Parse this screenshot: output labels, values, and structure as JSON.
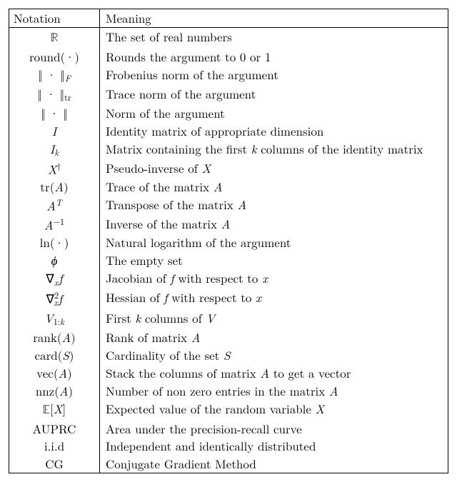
{
  "header": {
    "notation": "Notation",
    "meaning": "Meaning"
  },
  "rows": [
    {
      "n": "<span class='bb'>ℝ</span>",
      "m": "The set of real numbers"
    },
    {
      "n": "round(·)",
      "m": "Rounds the argument to 0 or 1"
    },
    {
      "n": "‖ · ‖<span class='subi'>F</span>",
      "m": "Frobenius norm of the argument"
    },
    {
      "n": "‖ · ‖<span class='sub'>tr</span>",
      "m": "Trace norm of the argument"
    },
    {
      "n": "‖ · ‖",
      "m": "Norm of the argument"
    },
    {
      "n": "<span class='mi'>I</span>",
      "m": "Identity matrix of appropriate dimension"
    },
    {
      "n": "<span class='mi'>I</span><span class='subi'>k</span>",
      "m": "Matrix containing the first <span class='mi'>k</span> columns of the identity matrix"
    },
    {
      "n": "<span class='mi'>X</span><span class='sup'>†</span>",
      "m": "Pseudo-inverse of <span class='mi'>X</span>"
    },
    {
      "n": "tr(<span class='mi'>A</span>)",
      "m": "Trace of the matrix <span class='mi'>A</span>"
    },
    {
      "n": "<span class='mi'>A</span><span class='supi'>T</span>",
      "m": "Transpose of the matrix <span class='mi'>A</span>"
    },
    {
      "n": "<span class='mi'>A</span><span class='sup'>−1</span>",
      "m": "Inverse of the matrix <span class='mi'>A</span>"
    },
    {
      "n": "ln(·)",
      "m": "Natural logarithm of the argument"
    },
    {
      "n": "<span class='mi'>ϕ</span>",
      "m": "The empty set"
    },
    {
      "n": "∇<span class='subi'>x</span><span class='mi'>&#8202;f</span>",
      "m": "Jacobian of <span class='mi'>f</span> with respect to <span class='mi'>x</span>"
    },
    {
      "n": "∇<span class='sup'>2</span><span class='subi' style='margin-left:-0.55em;'>x</span><span class='mi'>&#8202;f</span>",
      "m": "Hessian of <span class='mi'>f</span> with respect to <span class='mi'>x</span>"
    },
    {
      "n": "<span class='mi'>V</span><span class='sub'>1:<span class='mi'>k</span></span>",
      "m": "First <span class='mi'>k</span> columns of <span class='mi'>V</span>"
    },
    {
      "n": "rank(<span class='mi'>A</span>)",
      "m": "Rank of matrix <span class='mi'>A</span>"
    },
    {
      "n": "card(<span class='mi'>S</span>)",
      "m": "Cardinality of the set <span class='mi'>S</span>"
    },
    {
      "n": "vec(<span class='mi'>A</span>)",
      "m": "Stack the columns of matrix <span class='mi'>A</span> to get a vector"
    },
    {
      "n": "nnz(<span class='mi'>A</span>)",
      "m": "Number of non zero entries in the matrix <span class='mi'>A</span>"
    },
    {
      "n": "<span class='bb'>𝔼</span>[<span class='mi'>X</span>]",
      "m": "Expected value of the random variable <span class='mi'>X</span>"
    },
    {
      "n": "AUPRC",
      "m": "Area under the precision-recall curve"
    },
    {
      "n": "i.i.d",
      "m": "Independent and identically distributed"
    },
    {
      "n": "CG",
      "m": "Conjugate Gradient Method"
    }
  ],
  "chart_data": {
    "type": "table",
    "title": "Notation table",
    "columns": [
      "Notation",
      "Meaning"
    ],
    "records": [
      [
        "ℝ",
        "The set of real numbers"
      ],
      [
        "round(·)",
        "Rounds the argument to 0 or 1"
      ],
      [
        "‖·‖_F",
        "Frobenius norm of the argument"
      ],
      [
        "‖·‖_tr",
        "Trace norm of the argument"
      ],
      [
        "‖·‖",
        "Norm of the argument"
      ],
      [
        "I",
        "Identity matrix of appropriate dimension"
      ],
      [
        "I_k",
        "Matrix containing the first k columns of the identity matrix"
      ],
      [
        "X†",
        "Pseudo-inverse of X"
      ],
      [
        "tr(A)",
        "Trace of the matrix A"
      ],
      [
        "A^T",
        "Transpose of the matrix A"
      ],
      [
        "A^{-1}",
        "Inverse of the matrix A"
      ],
      [
        "ln(·)",
        "Natural logarithm of the argument"
      ],
      [
        "ϕ",
        "The empty set"
      ],
      [
        "∇_x f",
        "Jacobian of f with respect to x"
      ],
      [
        "∇_x^2 f",
        "Hessian of f with respect to x"
      ],
      [
        "V_{1:k}",
        "First k columns of V"
      ],
      [
        "rank(A)",
        "Rank of matrix A"
      ],
      [
        "card(S)",
        "Cardinality of the set S"
      ],
      [
        "vec(A)",
        "Stack the columns of matrix A to get a vector"
      ],
      [
        "nnz(A)",
        "Number of non zero entries in the matrix A"
      ],
      [
        "𝔼[X]",
        "Expected value of the random variable X"
      ],
      [
        "AUPRC",
        "Area under the precision-recall curve"
      ],
      [
        "i.i.d",
        "Independent and identically distributed"
      ],
      [
        "CG",
        "Conjugate Gradient Method"
      ]
    ]
  }
}
